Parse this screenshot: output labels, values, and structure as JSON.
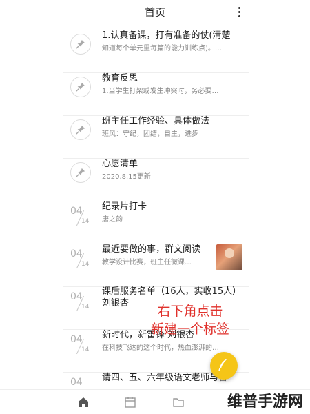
{
  "header": {
    "title": "首页",
    "more_icon": "more-vertical-icon"
  },
  "list": [
    {
      "type": "pinned",
      "title": "1.认真备课，打有准备的仗(清楚",
      "subtitle": "知道每个单元里每篇的能力训练点)。…"
    },
    {
      "type": "pinned",
      "title": "教育反思",
      "subtitle": "1.当学生打架或发生冲突时，务必要…"
    },
    {
      "type": "pinned",
      "title": "班主任工作经验、具体做法",
      "subtitle": "班风：守纪，团结，自主，进步"
    },
    {
      "type": "pinned",
      "title": "心愿清单",
      "subtitle": "2020.8.15更新"
    },
    {
      "type": "dated",
      "month": "04",
      "day": "14",
      "title": "纪录片打卡",
      "subtitle": "唐之韵"
    },
    {
      "type": "dated",
      "month": "04",
      "day": "14",
      "title": "最近要做的事，群文阅读",
      "subtitle": "教学设计比赛，班主任微课…",
      "has_thumb": true
    },
    {
      "type": "dated",
      "month": "04",
      "day": "14",
      "title": "课后服务名单（16人，实收15人）刘银杏",
      "subtitle": ""
    },
    {
      "type": "dated",
      "month": "04",
      "day": "14",
      "title": "新时代，新雷锋 刘银杏",
      "subtitle": "在科技飞达的这个时代，热血澎湃的…"
    },
    {
      "type": "dated",
      "month": "04",
      "day": "",
      "title": "请四、五、六年级语文老师与台",
      "subtitle": ""
    }
  ],
  "overlay_text": [
    "右下角点击",
    "新建一个标签"
  ],
  "fab": {
    "icon": "feather-pen-icon",
    "color": "#f5c518"
  },
  "tabs": [
    {
      "name": "home",
      "icon": "home-icon"
    },
    {
      "name": "calendar",
      "icon": "calendar-icon"
    },
    {
      "name": "folder",
      "icon": "folder-icon"
    }
  ],
  "watermark": "维普手游网",
  "colors": {
    "accent": "#f5c518",
    "overlay_text": "#e0312c"
  }
}
